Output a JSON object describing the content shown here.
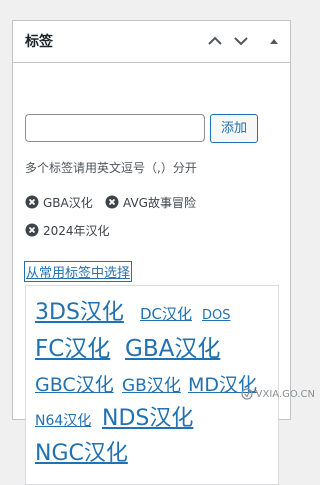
{
  "box": {
    "title": "标签",
    "add_button": "添加",
    "input_value": "",
    "input_placeholder": "",
    "hint": "多个标签请用英文逗号（,）分开",
    "tags": [
      "GBA汉化",
      "AVG故事冒险",
      "2024年汉化"
    ],
    "choose_link": "从常用标签中选择"
  },
  "cloud": {
    "tags": [
      "3DS汉化",
      "DC汉化",
      "DOS",
      "FC汉化",
      "GBA汉化",
      "GBC汉化",
      "GB汉化",
      "MD汉化",
      "N64汉化",
      "NDS汉化",
      "NGC汉化"
    ]
  },
  "watermark": {
    "text": "VXIA.GO.CN"
  },
  "colors": {
    "accent": "#2271b1",
    "border": "#c3c4c7",
    "background": "#f0f0f1"
  },
  "icons": [
    "chevron-up-icon",
    "chevron-down-icon",
    "caret-up-icon",
    "remove-tag-icon"
  ]
}
